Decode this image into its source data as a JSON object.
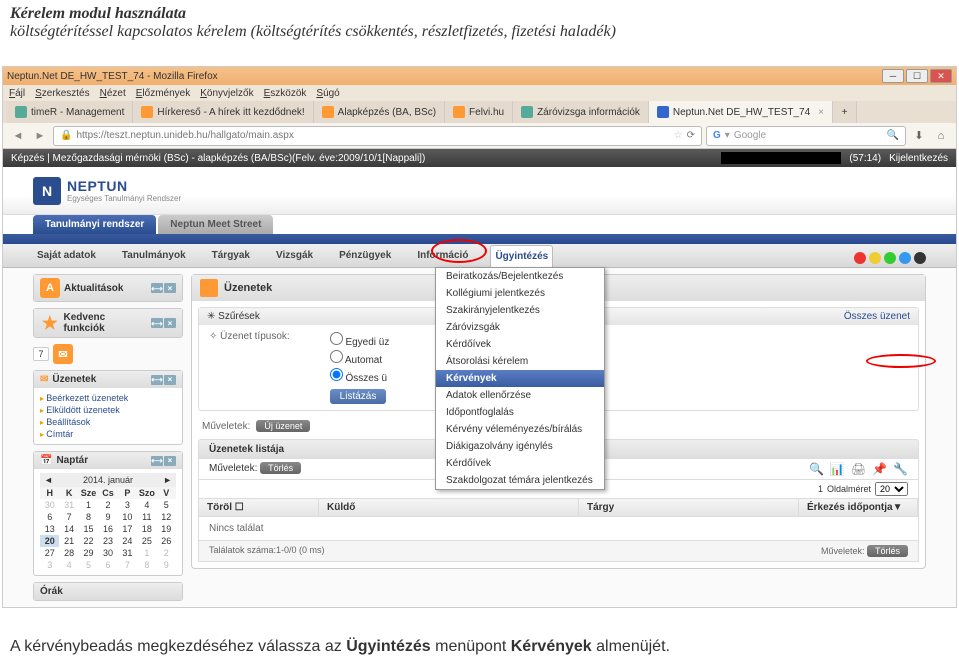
{
  "doc": {
    "title": "Kérelem modul használata",
    "sub": "költségtérítéssel kapcsolatos kérelem (költségtérítés csökkentés, részletfizetés, fizetési haladék)",
    "footer_pre": "A kérvénybeadás megkezdéséhez válassza az ",
    "footer_b1": "Ügyintézés",
    "footer_mid": " menüpont ",
    "footer_b2": "Kérvények",
    "footer_post": " almenüjét."
  },
  "firefox": {
    "title": "Neptun.Net DE_HW_TEST_74 - Mozilla Firefox",
    "menu": [
      "Fájl",
      "Szerkesztés",
      "Nézet",
      "Előzmények",
      "Könyvjelzők",
      "Eszközök",
      "Súgó"
    ],
    "tabs": [
      {
        "label": "timeR - Management"
      },
      {
        "label": "Hírkereső - A hírek itt kezdődnek!"
      },
      {
        "label": "Alapképzés (BA, BSc)"
      },
      {
        "label": "Felvi.hu"
      },
      {
        "label": "Záróvizsga információk"
      },
      {
        "label": "Neptun.Net DE_HW_TEST_74",
        "active": true
      }
    ],
    "url": "https://teszt.neptun.unideb.hu/hallgato/main.aspx",
    "search_placeholder": "Google",
    "back": "◄",
    "fwd": "►",
    "reload": "⟳",
    "home": "⌂",
    "dl": "⬇"
  },
  "app": {
    "breadcrumb": "Képzés | Mezőgazdasági mérnöki (BSc) - alapképzés (BA/BSc)(Felv. éve:2009/10/1[Nappali])",
    "timer": "(57:14)",
    "logout": "Kijelentkezés",
    "logo": "NEPTUN",
    "logo_sub": "Egységes Tanulmányi Rendszer",
    "ms_tabs": [
      "Tanulmányi rendszer",
      "Neptun Meet Street"
    ],
    "menu": [
      "Saját adatok",
      "Tanulmányok",
      "Tárgyak",
      "Vizsgák",
      "Pénzügyek",
      "Információ",
      "Ügyintézés"
    ],
    "dropdown": [
      "Beiratkozás/Bejelentkezés",
      "Kollégiumi jelentkezés",
      "Szakirányjelentkezés",
      "Záróvizsgák",
      "Kérdőívek",
      "Átsorolási kérelem",
      "Kérvények",
      "Adatok ellenőrzése",
      "Időpontfoglalás",
      "Kérvény véleményezés/bírálás",
      "Diákigazolvány igénylés",
      "Kérdőívek",
      "Szakdolgozat témára jelentkezés"
    ],
    "dd_highlight_index": 6
  },
  "sidebar": {
    "aktual": "Aktualitások",
    "kedvenc": "Kedvenc funkciók",
    "uzenetek": "Üzenetek",
    "uz_links": [
      "Beérkezett üzenetek",
      "Elküldött üzenetek",
      "Beállítások",
      "Címtár"
    ],
    "naptar": "Naptár",
    "orak": "Órák",
    "seven": "7"
  },
  "messages": {
    "title": "Üzenetek",
    "filters_label": "Szűrések",
    "all_msgs": "Összes üzenet",
    "type_label": "Üzenet típusok:",
    "r1": "Egyedi üz",
    "r2": "Automat",
    "r3": "Összes ü",
    "list_btn": "Listázás",
    "ops": "Műveletek:",
    "new_btn": "Új üzenet",
    "list_title": "Üzenetek listája",
    "del_btn": "Törlés",
    "cols": [
      "Töröl",
      "Küldő",
      "Tárgy",
      "Érkezés időpontja"
    ],
    "sort": "▼",
    "empty": "Nincs találat",
    "count": "Találatok száma:1-0/0 (0 ms)",
    "pager_label": "Oldalméret",
    "pager_val": "20",
    "page_num": "1",
    "footer_ops": "Műveletek:",
    "footer_del": "Törlés",
    "chk": "☐"
  },
  "calendar": {
    "month": "2014. január",
    "prev": "◄",
    "next": "►",
    "days": [
      "H",
      "K",
      "Sze",
      "Cs",
      "P",
      "Szo",
      "V"
    ],
    "grid": [
      [
        "30",
        "31",
        "1",
        "2",
        "3",
        "4",
        "5"
      ],
      [
        "6",
        "7",
        "8",
        "9",
        "10",
        "11",
        "12"
      ],
      [
        "13",
        "14",
        "15",
        "16",
        "17",
        "18",
        "19"
      ],
      [
        "20",
        "21",
        "22",
        "23",
        "24",
        "25",
        "26"
      ],
      [
        "27",
        "28",
        "29",
        "30",
        "31",
        "1",
        "2"
      ],
      [
        "3",
        "4",
        "5",
        "6",
        "7",
        "8",
        "9"
      ]
    ],
    "today": "20"
  },
  "colors": {
    "c1": "#e33",
    "c2": "#ec3",
    "c3": "#3c3",
    "c4": "#39e",
    "c5": "#333"
  }
}
